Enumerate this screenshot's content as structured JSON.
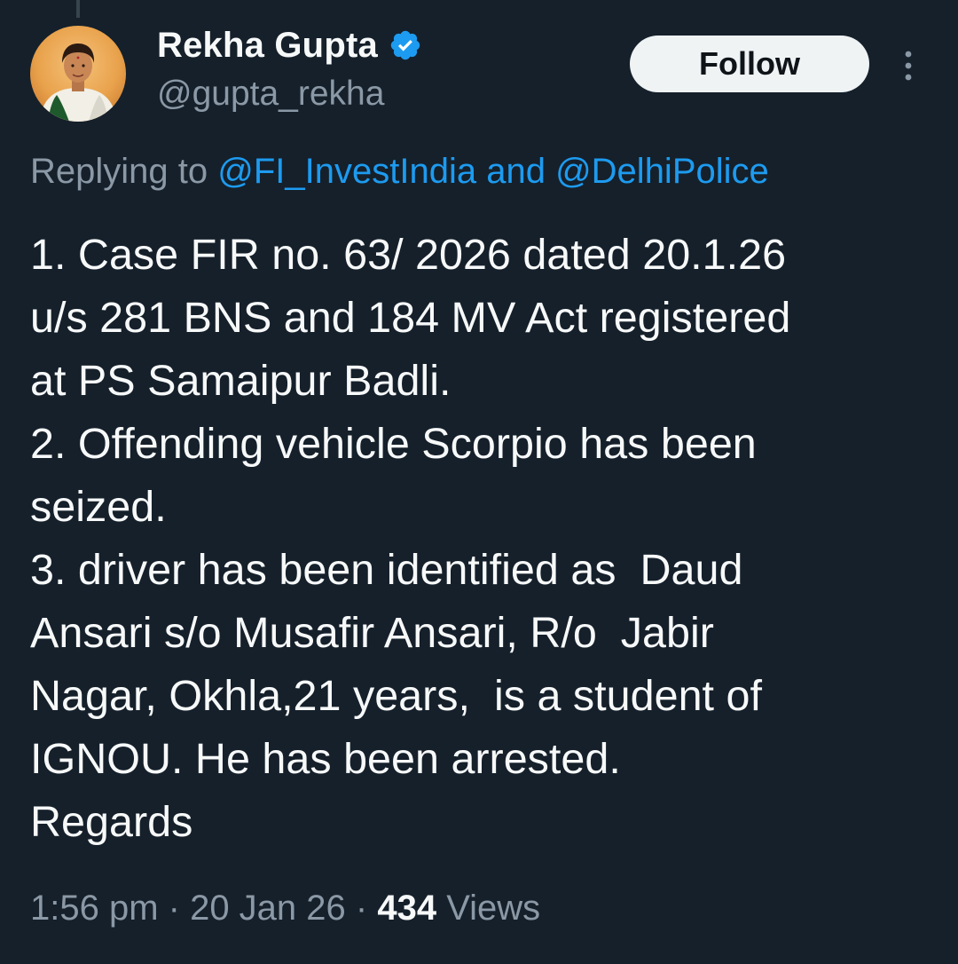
{
  "author": {
    "display_name": "Rekha Gupta",
    "handle": "@gupta_rekha",
    "verified": true,
    "verified_color": "#1d9bf0"
  },
  "follow_button": {
    "label": "Follow"
  },
  "reply": {
    "prefix": "Replying to ",
    "mention_1": "@FI_InvestIndia",
    "joiner": " and ",
    "mention_2": "@DelhiPolice"
  },
  "tweet": {
    "lines": [
      "1. Case FIR no. 63/ 2026 dated 20.1.26",
      "u/s 281 BNS and 184 MV Act registered",
      "at PS Samaipur Badli.",
      "2. Offending vehicle Scorpio has been",
      "seized.",
      "3. driver has been identified as  Daud",
      "Ansari s/o Musafir Ansari, R/o  Jabir",
      "Nagar, Okhla,21 years,  is a student of",
      "IGNOU. He has been arrested.",
      "Regards"
    ]
  },
  "meta": {
    "time": "1:56 pm",
    "separator": " · ",
    "date": "20 Jan 26",
    "views_count": "434",
    "views_label": " Views"
  },
  "colors": {
    "background": "#15202b",
    "text_primary": "#f7f9f9",
    "text_secondary": "#8b98a5",
    "link": "#1d9bf0"
  },
  "icons": {
    "verified": "verified-badge-icon",
    "more": "more-vertical-icon"
  }
}
